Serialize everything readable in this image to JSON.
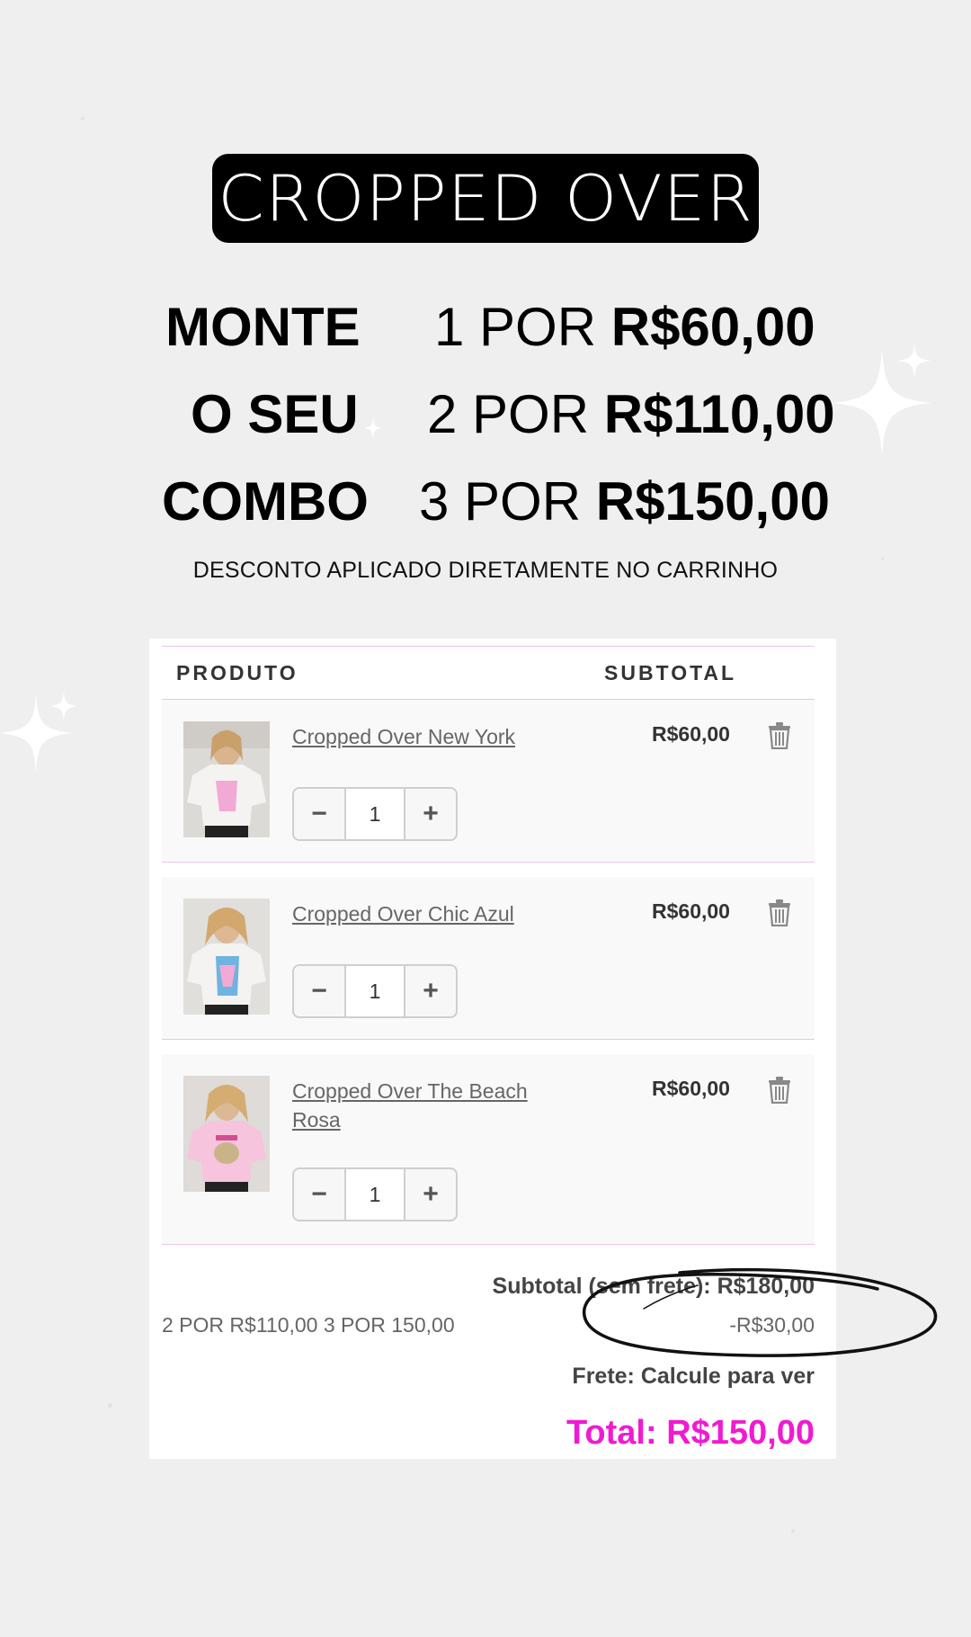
{
  "banner": {
    "title": "CROPPED OVER",
    "combo_words": [
      "MONTE",
      "O SEU",
      "COMBO"
    ],
    "offers": [
      {
        "qty_text": "1 POR",
        "price": "R$60,00"
      },
      {
        "qty_text": "2 POR",
        "price": "R$110,00"
      },
      {
        "qty_text": "3 POR",
        "price": "R$150,00"
      }
    ],
    "note": "DESCONTO APLICADO DIRETAMENTE NO CARRINHO"
  },
  "cart": {
    "header": {
      "product": "PRODUTO",
      "subtotal": "SUBTOTAL"
    },
    "items": [
      {
        "name": "Cropped Over New York",
        "price": "R$60,00",
        "qty": "1",
        "shirt_print": "#f2a9d6"
      },
      {
        "name": "Cropped Over Chic Azul",
        "price": "R$60,00",
        "qty": "1",
        "shirt_print": "#6fb3e0"
      },
      {
        "name": "Cropped Over The Beach Rosa",
        "price": "R$60,00",
        "qty": "1",
        "shirt_print": "#f6c4dc"
      }
    ],
    "qty_minus": "−",
    "qty_plus": "+",
    "subtotal_line": "Subtotal (sem frete): R$180,00",
    "promo_label": "2 POR R$110,00 3 POR 150,00",
    "promo_value": "-R$30,00",
    "frete_line": "Frete: Calcule para ver",
    "total_line": "Total: R$150,00"
  },
  "colors": {
    "background": "#efefef",
    "title_pill": "#000000",
    "divider": "#e9c6ea",
    "total_accent": "#f01bd1"
  },
  "icons": [
    "trash-icon",
    "sparkle-icon"
  ]
}
